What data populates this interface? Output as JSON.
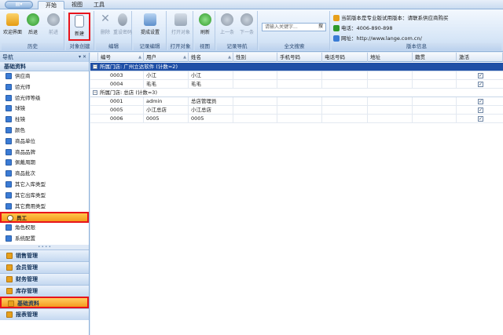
{
  "tabs": [
    "开始",
    "视图",
    "工具"
  ],
  "ribbon": {
    "groups": {
      "history": "历史",
      "object_create": "对象创建",
      "edit": "编辑",
      "record_edit": "记录编辑",
      "open_object": "打开对象",
      "view": "视图",
      "record_nav": "记录导航",
      "full_search": "全文搜索",
      "version_info": "版本信息"
    },
    "buttons": {
      "welcome": "欢迎界面",
      "back": "后退",
      "forward": "前进",
      "new": "新建",
      "delete": "删除",
      "reset_password": "重设密码",
      "submit_settings": "提成设置",
      "open_object": "打开对象",
      "refresh": "刷新",
      "prev": "上一条",
      "next": "下一条"
    },
    "search": {
      "placeholder": "请输入关键字...",
      "button": "搜"
    },
    "info": {
      "notice": "当前版本是专业版试用版本：请联系供应商购买",
      "phone": "电话：4006-890-898",
      "website": "网址：http://www.lange.com.cn/"
    }
  },
  "nav": {
    "title": "导航",
    "controls": "▾ ✕",
    "section": "基础资料",
    "items": [
      {
        "label": "供应商",
        "active": false
      },
      {
        "label": "验光师",
        "active": false
      },
      {
        "label": "验光师等级",
        "active": false
      },
      {
        "label": "球镜",
        "active": false
      },
      {
        "label": "柱镜",
        "active": false
      },
      {
        "label": "颜色",
        "active": false
      },
      {
        "label": "商品单位",
        "active": false
      },
      {
        "label": "商品品牌",
        "active": false
      },
      {
        "label": "佩戴周期",
        "active": false
      },
      {
        "label": "商品批次",
        "active": false
      },
      {
        "label": "其它入库类型",
        "active": false
      },
      {
        "label": "其它出库类型",
        "active": false
      },
      {
        "label": "其它费用类型",
        "active": false
      },
      {
        "label": "员工",
        "active": true
      },
      {
        "label": "角色权限",
        "active": false
      },
      {
        "label": "系统配置",
        "active": false
      }
    ],
    "modules": [
      {
        "label": "销售管理",
        "active": false
      },
      {
        "label": "会员管理",
        "active": false
      },
      {
        "label": "财务管理",
        "active": false
      },
      {
        "label": "库存管理",
        "active": false
      },
      {
        "label": "基础资料",
        "active": true
      },
      {
        "label": "报表管理",
        "active": false
      }
    ]
  },
  "grid": {
    "columns": [
      "编号",
      "用户",
      "姓名",
      "性别",
      "手机号码",
      "电话号码",
      "地址",
      "籍贯",
      "激活"
    ],
    "groups": [
      {
        "label": "所属门店: 广州立达软件 (计数=2)",
        "selected": true,
        "rows": [
          {
            "id": "0003",
            "user": "小江",
            "name": "小江",
            "active": "✓"
          },
          {
            "id": "0004",
            "user": "毛毛",
            "name": "毛毛",
            "active": "✓"
          }
        ]
      },
      {
        "label": "所属门店: 总店 (计数=3)",
        "selected": false,
        "rows": [
          {
            "id": "0001",
            "user": "admin",
            "name": "总店管理员",
            "active": "✓"
          },
          {
            "id": "0005",
            "user": "小江总店",
            "name": "小江总店",
            "active": "✓"
          },
          {
            "id": "0006",
            "user": "0005",
            "name": "0005",
            "active": "✓"
          }
        ]
      }
    ]
  },
  "colors": {
    "highlight": "#e8141c",
    "selected_row": "#1f4fa6",
    "active_item": "#f5a623"
  }
}
